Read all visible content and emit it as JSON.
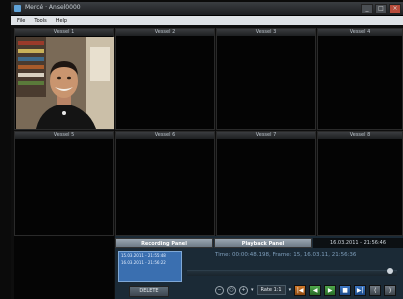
{
  "window": {
    "title": "Mercé · Ansel0000"
  },
  "menu": [
    "File",
    "Tools",
    "Help"
  ],
  "vessels": [
    "Vessel 1",
    "Vessel 2",
    "Vessel 3",
    "Vessel 4",
    "Vessel 5",
    "Vessel 6",
    "Vessel 7",
    "Vessel 8"
  ],
  "panel": {
    "recording_tab": "Recording Panel",
    "playback_tab": "Playback Panel",
    "datetime": "16.03.2011 - 21:56:46",
    "list": [
      "15.03.2011 - 21:55:48",
      "16.03.2011 - 21:56:22"
    ],
    "timecode": "Time: 00:00:48.198, Frame: 15, 16.03.11, 21:56:36",
    "delete_label": "DELETE",
    "rate_label": "Rate 1:1",
    "buttons": [
      "|◀",
      "◀",
      "▶",
      "■",
      "▶|",
      "⟨",
      "⟩"
    ]
  },
  "colors": {
    "accent": "#3a6fb0",
    "panel_bg": "#1b2a36"
  }
}
